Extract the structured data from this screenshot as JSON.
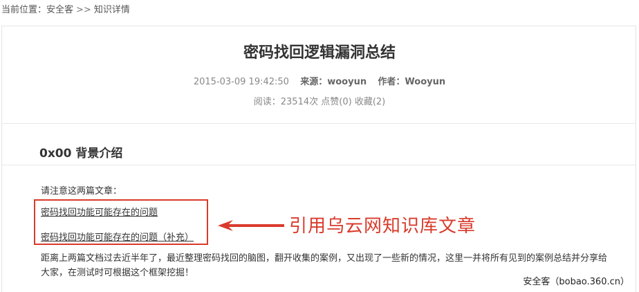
{
  "breadcrumb": {
    "label": "当前位置：",
    "home": "安全客",
    "separator": ">>",
    "current": "知识详情"
  },
  "article": {
    "title": "密码找回逻辑漏洞总结",
    "date": "2015-03-09 19:42:50",
    "source_label": "来源：",
    "source_value": "wooyun",
    "author_label": "作者：",
    "author_value": "Wooyun",
    "reads": "阅读：23514次",
    "likes": "点赞(0)",
    "favorites": "收藏(2)"
  },
  "section": {
    "heading": "0x00 背景介绍",
    "notice": "请注意这两篇文章：",
    "link1": "密码找回功能可能存在的问题",
    "link2": "密码找回功能可能存在的问题（补充）",
    "paragraph": "距离上两篇文档过去近半年了，最近整理密码找回的脑图，翻开收集的案例，又出现了一些新的情况，这里一并将所有见到的案例总结并分享给大家，在测试时可根据这个框架挖掘！"
  },
  "annotation": {
    "text": "引用乌云网知识库文章",
    "color": "#d93a2b"
  },
  "watermark": {
    "text": "安全客（bobao.360.cn）"
  }
}
